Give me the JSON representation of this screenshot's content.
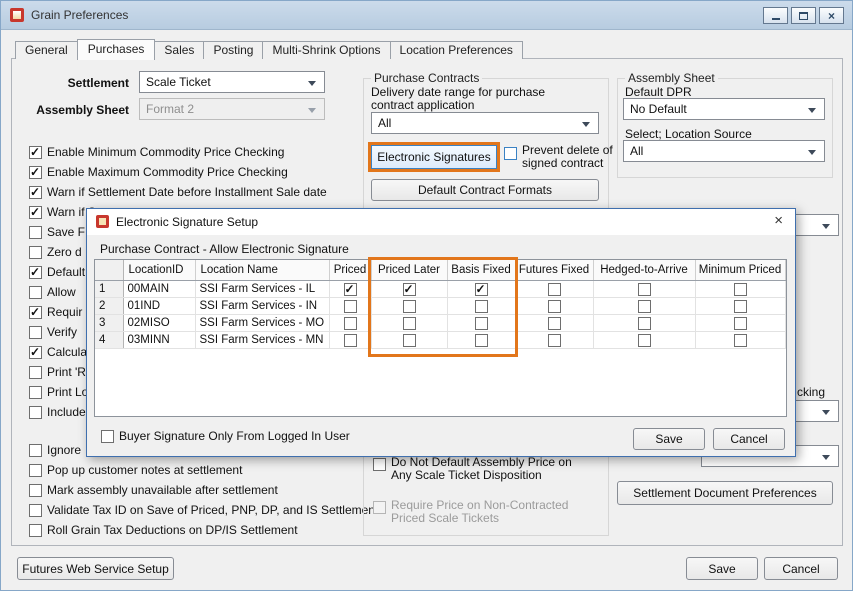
{
  "window": {
    "title": "Grain Preferences"
  },
  "icons": {
    "close": "×"
  },
  "colors": {
    "highlight": "#e2761b",
    "modal_border": "#3f6fae"
  },
  "tabs": [
    "General",
    "Purchases",
    "Sales",
    "Posting",
    "Multi-Shrink Options",
    "Location Preferences"
  ],
  "form": {
    "settlement_label": "Settlement",
    "settlement_value": "Scale Ticket",
    "assembly_sheet_label": "Assembly Sheet",
    "assembly_sheet_value": "Format 2"
  },
  "left_checkboxes": [
    {
      "label": "Enable Minimum Commodity Price Checking",
      "checked": true
    },
    {
      "label": "Enable Maximum Commodity Price Checking",
      "checked": true
    },
    {
      "label": "Warn if Settlement Date before  Installment Sale date",
      "checked": true
    },
    {
      "label": "Warn if S",
      "checked": true
    },
    {
      "label": "Save F",
      "checked": false
    },
    {
      "label": "Zero d",
      "checked": false
    },
    {
      "label": "Default",
      "checked": true
    },
    {
      "label": "Allow",
      "checked": false
    },
    {
      "label": "Requir",
      "checked": true
    },
    {
      "label": "Verify",
      "checked": false
    },
    {
      "label": "Calcula",
      "checked": true
    },
    {
      "label": "Print 'R",
      "checked": false
    },
    {
      "label": "Print Lo",
      "checked": false
    },
    {
      "label": "Include",
      "checked": false
    },
    {
      "label": "Ignore",
      "checked": false
    },
    {
      "label": "Pop up customer notes at settlement",
      "checked": false
    },
    {
      "label": "Mark assembly unavailable after settlement",
      "checked": false
    },
    {
      "label": "Validate Tax ID on Save of Priced, PNP, DP, and IS Settlements",
      "checked": false
    },
    {
      "label": "Roll Grain Tax Deductions on DP/IS Settlement",
      "checked": false
    }
  ],
  "purchase_contracts": {
    "title": "Purchase Contracts",
    "delivery_line1": "Delivery date range for purchase",
    "delivery_line2": "contract application",
    "delivery_value": "All",
    "electronic_signatures": "Electronic Signatures",
    "prevent_delete_line1": "Prevent delete of",
    "prevent_delete_line2": "signed contract",
    "prevent_delete_checked": false,
    "default_contract_formats": "Default Contract Formats",
    "do_not_default_line1": "Do Not Default Assembly Price on",
    "do_not_default_line2": "Any Scale Ticket Disposition",
    "do_not_default_checked": false,
    "require_price_line1": "Require Price on Non-Contracted",
    "require_price_line2": "Priced Scale Tickets",
    "require_price_checked": false
  },
  "assembly_sheet_group": {
    "title": "Assembly Sheet",
    "default_dpr_label": "Default DPR",
    "default_dpr_value": "No Default",
    "location_source_label": "Select; Location Source",
    "location_source_value": "All"
  },
  "right_fragments": {
    "label": "cking"
  },
  "settlement_documents_button": "Settlement Document Preferences",
  "modal": {
    "title": "Electronic Signature Setup",
    "subtitle": "Purchase Contract - Allow Electronic Signature",
    "columns": [
      "LocationID",
      "Location Name",
      "Priced",
      "Priced Later",
      "Basis Fixed",
      "Futures Fixed",
      "Hedged-to-Arrive",
      "Minimum Priced"
    ],
    "rows": [
      {
        "num": "1",
        "location_id": "00MAIN",
        "location_name": "SSI Farm Services - IL",
        "checks": [
          true,
          true,
          true,
          false,
          false,
          false
        ]
      },
      {
        "num": "2",
        "location_id": "01IND",
        "location_name": "SSI Farm Services - IN",
        "checks": [
          false,
          false,
          false,
          false,
          false,
          false
        ]
      },
      {
        "num": "3",
        "location_id": "02MISO",
        "location_name": "SSI Farm Services - MO",
        "checks": [
          false,
          false,
          false,
          false,
          false,
          false
        ]
      },
      {
        "num": "4",
        "location_id": "03MINN",
        "location_name": "SSI Farm Services - MN",
        "checks": [
          false,
          false,
          false,
          false,
          false,
          false
        ]
      }
    ],
    "buyer_signature_label": "Buyer Signature Only From Logged In User",
    "buyer_signature_checked": false,
    "save": "Save",
    "cancel": "Cancel"
  },
  "footer": {
    "futures_web_service_setup": "Futures Web Service Setup",
    "save": "Save",
    "cancel": "Cancel"
  }
}
